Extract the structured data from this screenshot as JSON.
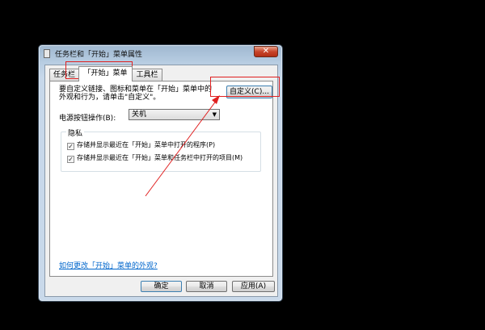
{
  "window": {
    "title": "任务栏和「开始」菜单属性",
    "close_label": "✕"
  },
  "tabs": [
    {
      "label": "任务栏",
      "selected": false
    },
    {
      "label": "「开始」菜单",
      "selected": true
    },
    {
      "label": "工具栏",
      "selected": false
    }
  ],
  "start_menu": {
    "description_line1": "要自定义链接、图标和菜单在「开始」菜单中的",
    "description_line2": "外观和行为，请单击\"自定义\"。",
    "customize_button": "自定义(C)...",
    "power_label": "电源按钮操作(B):",
    "power_value": "关机",
    "privacy_title": "隐私",
    "privacy_items": [
      {
        "label": "存储并显示最近在「开始」菜单中打开的程序(P)",
        "checked": true
      },
      {
        "label": "存储并显示最近在「开始」菜单和任务栏中打开的项目(M)",
        "checked": true
      }
    ],
    "help_link": "如何更改「开始」菜单的外观?"
  },
  "buttons": {
    "ok": "确定",
    "cancel": "取消",
    "apply": "应用(A)"
  },
  "colors": {
    "annotation": "#e02020",
    "link": "#0066cc"
  }
}
